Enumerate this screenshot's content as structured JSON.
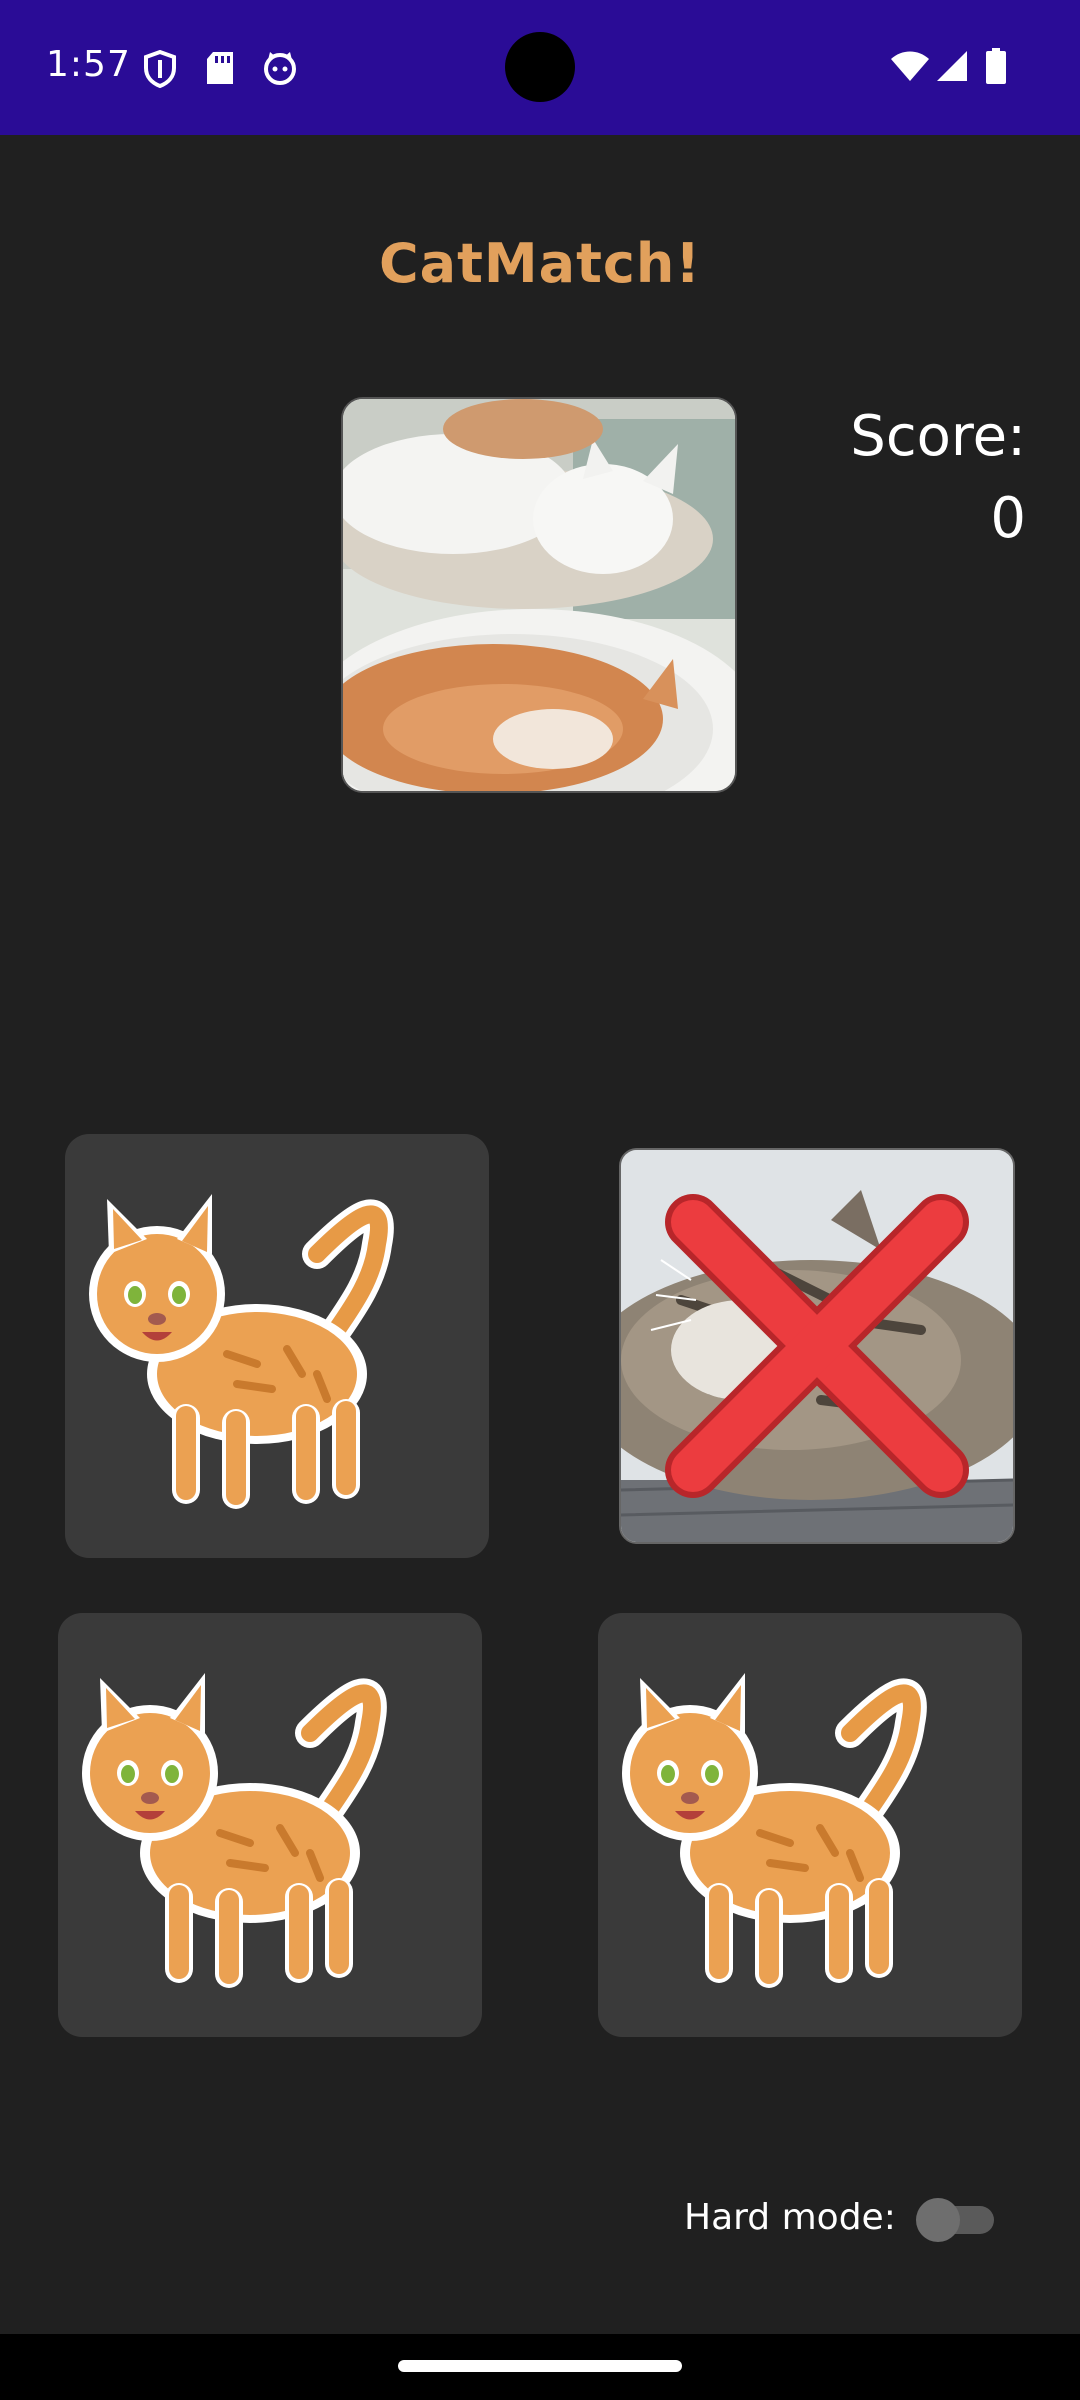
{
  "status_bar": {
    "time": "1:57",
    "icons": [
      "shield-icon",
      "sd-card-icon",
      "cat-face-icon",
      "wifi-icon",
      "signal-icon",
      "battery-icon"
    ]
  },
  "app": {
    "title": "CatMatch!",
    "score_label": "Score:",
    "score_value": "0",
    "hard_mode_label": "Hard mode:",
    "hard_mode_enabled": false
  },
  "target_image": "two-cats-sleeping-in-bowls",
  "cards": [
    {
      "state": "face-down",
      "icon": "cartoon-cat-icon"
    },
    {
      "state": "revealed-wrong",
      "icon": "cat-photo-with-red-x"
    },
    {
      "state": "face-down",
      "icon": "cartoon-cat-icon"
    },
    {
      "state": "face-down",
      "icon": "cartoon-cat-icon"
    }
  ],
  "colors": {
    "status_bar": "#2a0c96",
    "background": "#202020",
    "card": "#3a3a3a",
    "title": "#e1a05c",
    "wrong_mark": "#e8373a"
  }
}
